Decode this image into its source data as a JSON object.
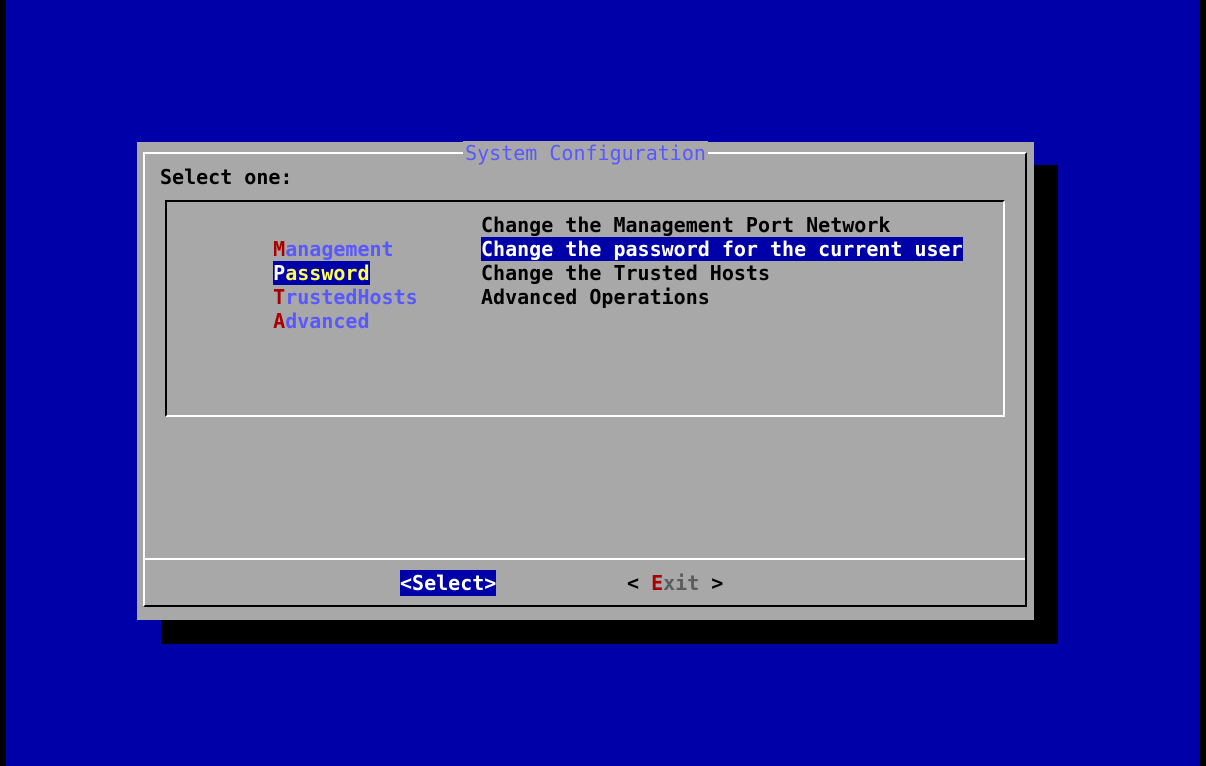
{
  "dialog": {
    "title": "System Configuration",
    "prompt": "Select one:"
  },
  "menu": {
    "items": [
      {
        "hotkey": "M",
        "rest": "anagement",
        "description": "Change the Management Port Network",
        "selected": false
      },
      {
        "hotkey": "P",
        "rest": "assword",
        "description": "Change the password for the current user",
        "selected": true
      },
      {
        "hotkey": "T",
        "rest": "rustedHosts",
        "description": "Change the Trusted Hosts",
        "selected": false
      },
      {
        "hotkey": "A",
        "rest": "dvanced",
        "description": "Advanced Operations",
        "selected": false
      }
    ]
  },
  "buttons": {
    "select_label": "<Select>",
    "exit_open": "< ",
    "exit_hotkey": "E",
    "exit_rest": "xit",
    "exit_close": " >"
  },
  "colors": {
    "background": "#0000a8",
    "dialog": "#a8a8a8",
    "highlight": "#0000a8",
    "tag_text": "#5858ff",
    "hotkey": "#a80000"
  }
}
